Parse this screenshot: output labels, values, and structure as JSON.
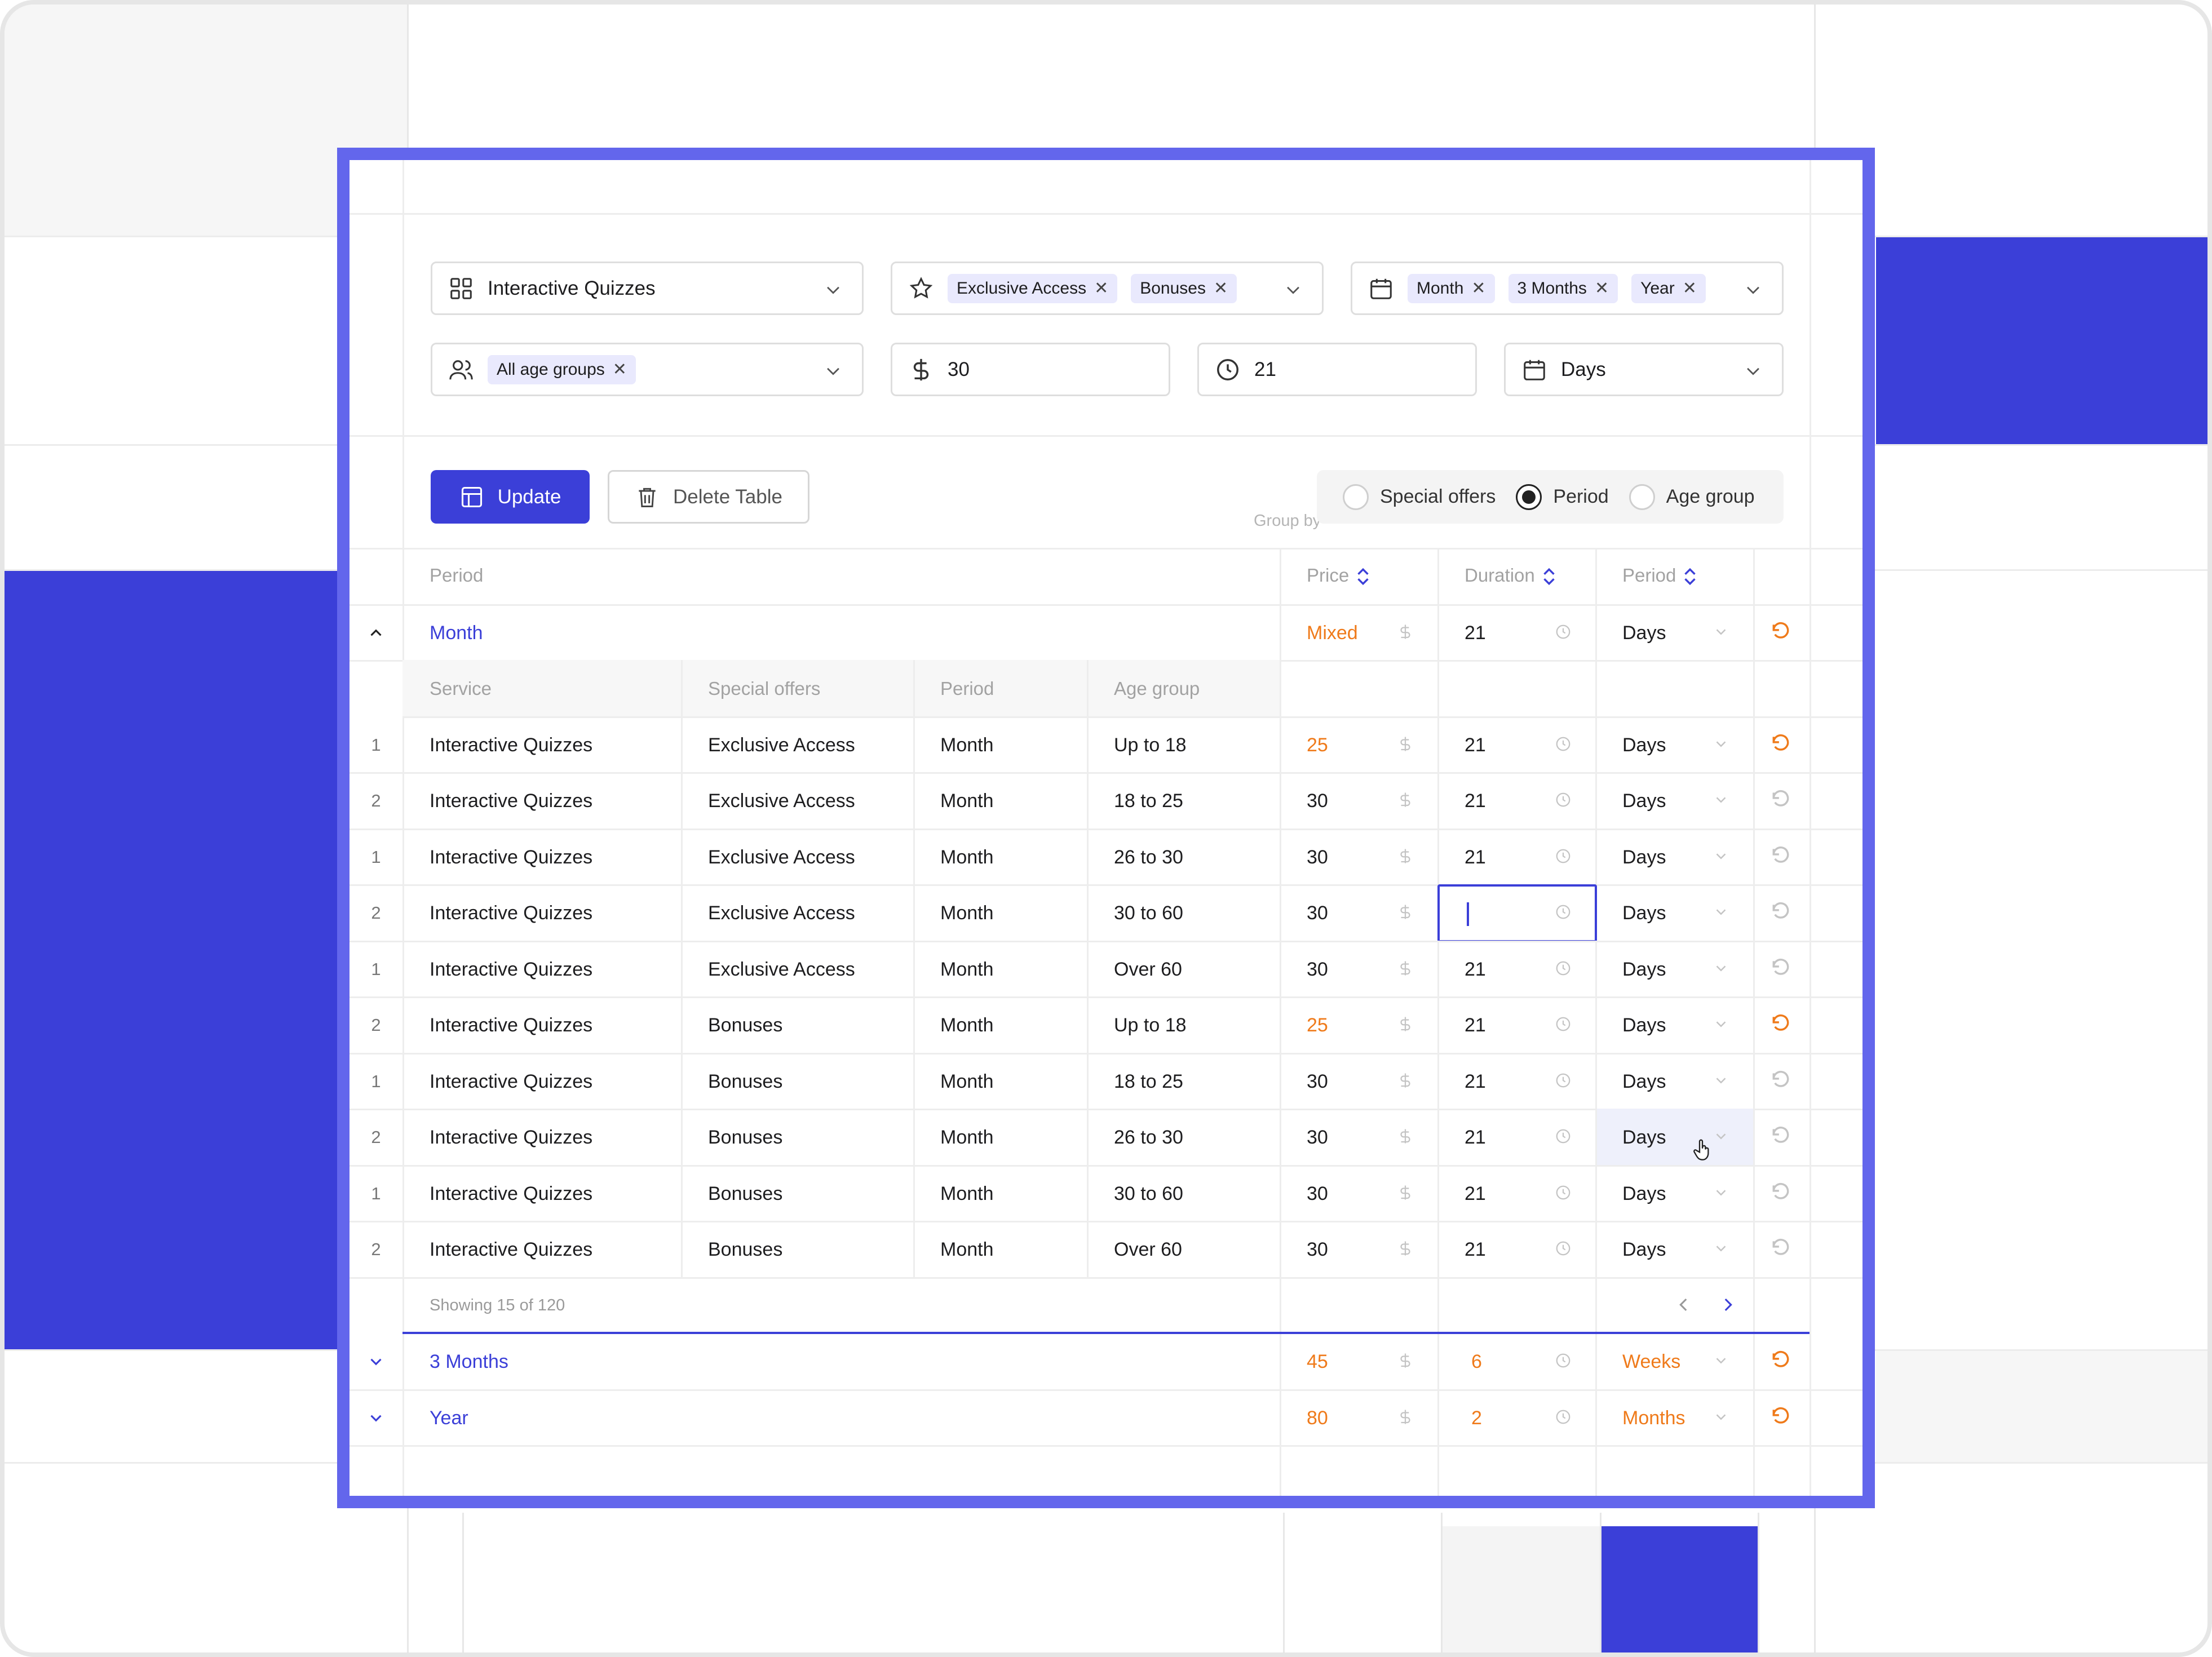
{
  "filters": {
    "service": {
      "value": "Interactive Quizzes",
      "icon": "grid-icon"
    },
    "offers": {
      "chips": [
        "Exclusive Access",
        "Bonuses"
      ],
      "icon": "star-icon"
    },
    "periods": {
      "chips": [
        "Month",
        "3 Months",
        "Year"
      ],
      "icon": "calendar-icon"
    },
    "age_groups": {
      "chips": [
        "All age groups"
      ],
      "icon": "users-icon"
    },
    "price": {
      "value": "30",
      "icon": "dollar-icon"
    },
    "duration": {
      "value": "21",
      "icon": "clock-icon"
    },
    "unit": {
      "value": "Days",
      "icon": "calendar-icon"
    }
  },
  "toolbar": {
    "update_label": "Update",
    "delete_label": "Delete Table",
    "group_by_label": "Group by",
    "group_options": [
      "Special offers",
      "Period",
      "Age group"
    ],
    "group_selected": "Period"
  },
  "table": {
    "group_header": [
      "Period",
      "Price",
      "Duration",
      "Period"
    ],
    "sub_header": [
      "Service",
      "Special offers",
      "Period",
      "Age group"
    ],
    "month_group": {
      "label": "Month",
      "price": "Mixed",
      "duration": "21",
      "unit": "Days"
    },
    "rows": [
      {
        "idx": "1",
        "service": "Interactive Quizzes",
        "offer": "Exclusive Access",
        "period": "Month",
        "age": "Up to 18",
        "price": "25",
        "duration": "21",
        "unit": "Days",
        "modified": true
      },
      {
        "idx": "2",
        "service": "Interactive Quizzes",
        "offer": "Exclusive Access",
        "period": "Month",
        "age": "18 to 25",
        "price": "30",
        "duration": "21",
        "unit": "Days",
        "modified": false
      },
      {
        "idx": "1",
        "service": "Interactive Quizzes",
        "offer": "Exclusive Access",
        "period": "Month",
        "age": "26 to 30",
        "price": "30",
        "duration": "21",
        "unit": "Days",
        "modified": false
      },
      {
        "idx": "2",
        "service": "Interactive Quizzes",
        "offer": "Exclusive Access",
        "period": "Month",
        "age": "30 to 60",
        "price": "30",
        "duration": "",
        "unit": "Days",
        "modified": false,
        "editing": true
      },
      {
        "idx": "1",
        "service": "Interactive Quizzes",
        "offer": "Exclusive Access",
        "period": "Month",
        "age": "Over 60",
        "price": "30",
        "duration": "21",
        "unit": "Days",
        "modified": false
      },
      {
        "idx": "2",
        "service": "Interactive Quizzes",
        "offer": "Bonuses",
        "period": "Month",
        "age": "Up to 18",
        "price": "25",
        "duration": "21",
        "unit": "Days",
        "modified": true
      },
      {
        "idx": "1",
        "service": "Interactive Quizzes",
        "offer": "Bonuses",
        "period": "Month",
        "age": "18 to 25",
        "price": "30",
        "duration": "21",
        "unit": "Days",
        "modified": false
      },
      {
        "idx": "2",
        "service": "Interactive Quizzes",
        "offer": "Bonuses",
        "period": "Month",
        "age": "26 to 30",
        "price": "30",
        "duration": "21",
        "unit": "Days",
        "modified": false,
        "hover": true
      },
      {
        "idx": "1",
        "service": "Interactive Quizzes",
        "offer": "Bonuses",
        "period": "Month",
        "age": "30 to 60",
        "price": "30",
        "duration": "21",
        "unit": "Days",
        "modified": false
      },
      {
        "idx": "2",
        "service": "Interactive Quizzes",
        "offer": "Bonuses",
        "period": "Month",
        "age": "Over 60",
        "price": "30",
        "duration": "21",
        "unit": "Days",
        "modified": false
      }
    ],
    "pagination": "Showing 15 of 120",
    "other_groups": [
      {
        "label": "3 Months",
        "price": "45",
        "duration": "6",
        "unit": "Weeks"
      },
      {
        "label": "Year",
        "price": "80",
        "duration": "2",
        "unit": "Months"
      }
    ]
  },
  "colors": {
    "accent": "#3b3fd8",
    "panel_border": "#6366ec",
    "modified": "#ef7a1a"
  }
}
